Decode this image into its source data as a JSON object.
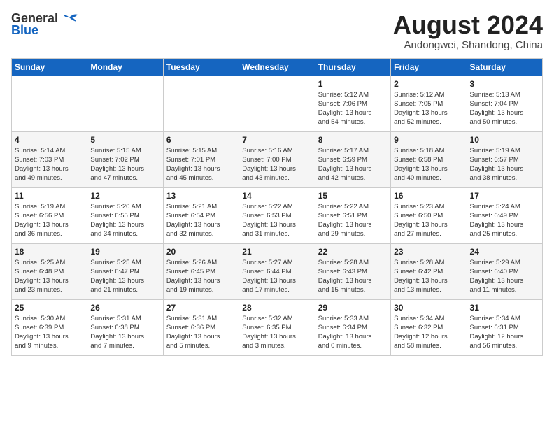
{
  "header": {
    "logo_general": "General",
    "logo_blue": "Blue",
    "month_year": "August 2024",
    "location": "Andongwei, Shandong, China"
  },
  "days_of_week": [
    "Sunday",
    "Monday",
    "Tuesday",
    "Wednesday",
    "Thursday",
    "Friday",
    "Saturday"
  ],
  "weeks": [
    [
      {
        "day": "",
        "info": ""
      },
      {
        "day": "",
        "info": ""
      },
      {
        "day": "",
        "info": ""
      },
      {
        "day": "",
        "info": ""
      },
      {
        "day": "1",
        "info": "Sunrise: 5:12 AM\nSunset: 7:06 PM\nDaylight: 13 hours\nand 54 minutes."
      },
      {
        "day": "2",
        "info": "Sunrise: 5:12 AM\nSunset: 7:05 PM\nDaylight: 13 hours\nand 52 minutes."
      },
      {
        "day": "3",
        "info": "Sunrise: 5:13 AM\nSunset: 7:04 PM\nDaylight: 13 hours\nand 50 minutes."
      }
    ],
    [
      {
        "day": "4",
        "info": "Sunrise: 5:14 AM\nSunset: 7:03 PM\nDaylight: 13 hours\nand 49 minutes."
      },
      {
        "day": "5",
        "info": "Sunrise: 5:15 AM\nSunset: 7:02 PM\nDaylight: 13 hours\nand 47 minutes."
      },
      {
        "day": "6",
        "info": "Sunrise: 5:15 AM\nSunset: 7:01 PM\nDaylight: 13 hours\nand 45 minutes."
      },
      {
        "day": "7",
        "info": "Sunrise: 5:16 AM\nSunset: 7:00 PM\nDaylight: 13 hours\nand 43 minutes."
      },
      {
        "day": "8",
        "info": "Sunrise: 5:17 AM\nSunset: 6:59 PM\nDaylight: 13 hours\nand 42 minutes."
      },
      {
        "day": "9",
        "info": "Sunrise: 5:18 AM\nSunset: 6:58 PM\nDaylight: 13 hours\nand 40 minutes."
      },
      {
        "day": "10",
        "info": "Sunrise: 5:19 AM\nSunset: 6:57 PM\nDaylight: 13 hours\nand 38 minutes."
      }
    ],
    [
      {
        "day": "11",
        "info": "Sunrise: 5:19 AM\nSunset: 6:56 PM\nDaylight: 13 hours\nand 36 minutes."
      },
      {
        "day": "12",
        "info": "Sunrise: 5:20 AM\nSunset: 6:55 PM\nDaylight: 13 hours\nand 34 minutes."
      },
      {
        "day": "13",
        "info": "Sunrise: 5:21 AM\nSunset: 6:54 PM\nDaylight: 13 hours\nand 32 minutes."
      },
      {
        "day": "14",
        "info": "Sunrise: 5:22 AM\nSunset: 6:53 PM\nDaylight: 13 hours\nand 31 minutes."
      },
      {
        "day": "15",
        "info": "Sunrise: 5:22 AM\nSunset: 6:51 PM\nDaylight: 13 hours\nand 29 minutes."
      },
      {
        "day": "16",
        "info": "Sunrise: 5:23 AM\nSunset: 6:50 PM\nDaylight: 13 hours\nand 27 minutes."
      },
      {
        "day": "17",
        "info": "Sunrise: 5:24 AM\nSunset: 6:49 PM\nDaylight: 13 hours\nand 25 minutes."
      }
    ],
    [
      {
        "day": "18",
        "info": "Sunrise: 5:25 AM\nSunset: 6:48 PM\nDaylight: 13 hours\nand 23 minutes."
      },
      {
        "day": "19",
        "info": "Sunrise: 5:25 AM\nSunset: 6:47 PM\nDaylight: 13 hours\nand 21 minutes."
      },
      {
        "day": "20",
        "info": "Sunrise: 5:26 AM\nSunset: 6:45 PM\nDaylight: 13 hours\nand 19 minutes."
      },
      {
        "day": "21",
        "info": "Sunrise: 5:27 AM\nSunset: 6:44 PM\nDaylight: 13 hours\nand 17 minutes."
      },
      {
        "day": "22",
        "info": "Sunrise: 5:28 AM\nSunset: 6:43 PM\nDaylight: 13 hours\nand 15 minutes."
      },
      {
        "day": "23",
        "info": "Sunrise: 5:28 AM\nSunset: 6:42 PM\nDaylight: 13 hours\nand 13 minutes."
      },
      {
        "day": "24",
        "info": "Sunrise: 5:29 AM\nSunset: 6:40 PM\nDaylight: 13 hours\nand 11 minutes."
      }
    ],
    [
      {
        "day": "25",
        "info": "Sunrise: 5:30 AM\nSunset: 6:39 PM\nDaylight: 13 hours\nand 9 minutes."
      },
      {
        "day": "26",
        "info": "Sunrise: 5:31 AM\nSunset: 6:38 PM\nDaylight: 13 hours\nand 7 minutes."
      },
      {
        "day": "27",
        "info": "Sunrise: 5:31 AM\nSunset: 6:36 PM\nDaylight: 13 hours\nand 5 minutes."
      },
      {
        "day": "28",
        "info": "Sunrise: 5:32 AM\nSunset: 6:35 PM\nDaylight: 13 hours\nand 3 minutes."
      },
      {
        "day": "29",
        "info": "Sunrise: 5:33 AM\nSunset: 6:34 PM\nDaylight: 13 hours\nand 0 minutes."
      },
      {
        "day": "30",
        "info": "Sunrise: 5:34 AM\nSunset: 6:32 PM\nDaylight: 12 hours\nand 58 minutes."
      },
      {
        "day": "31",
        "info": "Sunrise: 5:34 AM\nSunset: 6:31 PM\nDaylight: 12 hours\nand 56 minutes."
      }
    ]
  ]
}
